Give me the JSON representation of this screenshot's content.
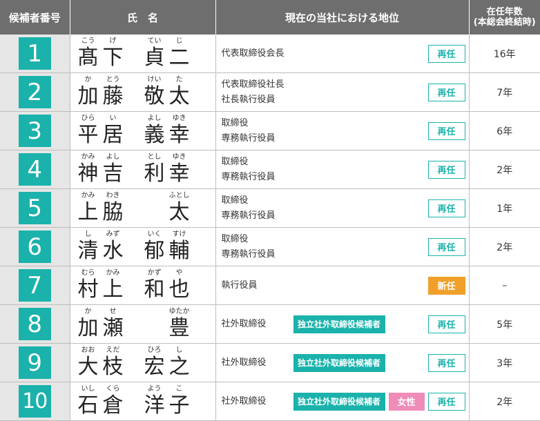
{
  "headers": {
    "number": "候補者番号",
    "name": "氏　名",
    "position": "現在の当社における地位",
    "years": "在任年数",
    "years_sub": "(本総会終結時)"
  },
  "colors": {
    "teal": "#1ab2ab",
    "orange": "#f0a02a",
    "pink": "#f08cb8",
    "header_gray": "#6e6e6e"
  },
  "rows": [
    {
      "num": "1",
      "ruby_a": [
        "こう",
        "げ"
      ],
      "kanji_a": [
        "髙",
        "下"
      ],
      "ruby_b": [
        "てい",
        "じ"
      ],
      "kanji_b": [
        "貞",
        "二"
      ],
      "pos1": "代表取締役会長",
      "pos2": "",
      "status": "再任",
      "indep": "",
      "female": "",
      "years": "16年"
    },
    {
      "num": "2",
      "ruby_a": [
        "か",
        "とう"
      ],
      "kanji_a": [
        "加",
        "藤"
      ],
      "ruby_b": [
        "けい",
        "た"
      ],
      "kanji_b": [
        "敬",
        "太"
      ],
      "pos1": "代表取締役社長",
      "pos2": "社長執行役員",
      "status": "再任",
      "indep": "",
      "female": "",
      "years": "7年"
    },
    {
      "num": "3",
      "ruby_a": [
        "ひら",
        "い"
      ],
      "kanji_a": [
        "平",
        "居"
      ],
      "ruby_b": [
        "よし",
        "ゆき"
      ],
      "kanji_b": [
        "義",
        "幸"
      ],
      "pos1": "取締役",
      "pos2": "専務執行役員",
      "status": "再任",
      "indep": "",
      "female": "",
      "years": "6年"
    },
    {
      "num": "4",
      "ruby_a": [
        "かみ",
        "よし"
      ],
      "kanji_a": [
        "神",
        "吉"
      ],
      "ruby_b": [
        "とし",
        "ゆき"
      ],
      "kanji_b": [
        "利",
        "幸"
      ],
      "pos1": "取締役",
      "pos2": "専務執行役員",
      "status": "再任",
      "indep": "",
      "female": "",
      "years": "2年"
    },
    {
      "num": "5",
      "ruby_a": [
        "かみ",
        "わき"
      ],
      "kanji_a": [
        "上",
        "脇"
      ],
      "ruby_b": [
        "",
        "ふとし"
      ],
      "kanji_b": [
        "",
        "太"
      ],
      "pos1": "取締役",
      "pos2": "専務執行役員",
      "status": "再任",
      "indep": "",
      "female": "",
      "years": "1年"
    },
    {
      "num": "6",
      "ruby_a": [
        "し",
        "みず"
      ],
      "kanji_a": [
        "清",
        "水"
      ],
      "ruby_b": [
        "いく",
        "すけ"
      ],
      "kanji_b": [
        "郁",
        "輔"
      ],
      "pos1": "取締役",
      "pos2": "専務執行役員",
      "status": "再任",
      "indep": "",
      "female": "",
      "years": "2年"
    },
    {
      "num": "7",
      "ruby_a": [
        "むら",
        "かみ"
      ],
      "kanji_a": [
        "村",
        "上"
      ],
      "ruby_b": [
        "かず",
        "や"
      ],
      "kanji_b": [
        "和",
        "也"
      ],
      "pos1": "執行役員",
      "pos2": "",
      "status": "新任",
      "indep": "",
      "female": "",
      "years": "–"
    },
    {
      "num": "8",
      "ruby_a": [
        "か",
        "せ"
      ],
      "kanji_a": [
        "加",
        "瀬"
      ],
      "ruby_b": [
        "",
        "ゆたか"
      ],
      "kanji_b": [
        "",
        "豊"
      ],
      "pos1": "社外取締役",
      "pos2": "",
      "status": "再任",
      "indep": "独立社外取締役候補者",
      "female": "",
      "years": "5年"
    },
    {
      "num": "9",
      "ruby_a": [
        "おお",
        "えだ"
      ],
      "kanji_a": [
        "大",
        "枝"
      ],
      "ruby_b": [
        "ひろ",
        "し"
      ],
      "kanji_b": [
        "宏",
        "之"
      ],
      "pos1": "社外取締役",
      "pos2": "",
      "status": "再任",
      "indep": "独立社外取締役候補者",
      "female": "",
      "years": "3年"
    },
    {
      "num": "10",
      "ruby_a": [
        "いし",
        "くら"
      ],
      "kanji_a": [
        "石",
        "倉"
      ],
      "ruby_b": [
        "よう",
        "こ"
      ],
      "kanji_b": [
        "洋",
        "子"
      ],
      "pos1": "社外取締役",
      "pos2": "",
      "status": "再任",
      "indep": "独立社外取締役候補者",
      "female": "女性",
      "years": "2年"
    }
  ]
}
